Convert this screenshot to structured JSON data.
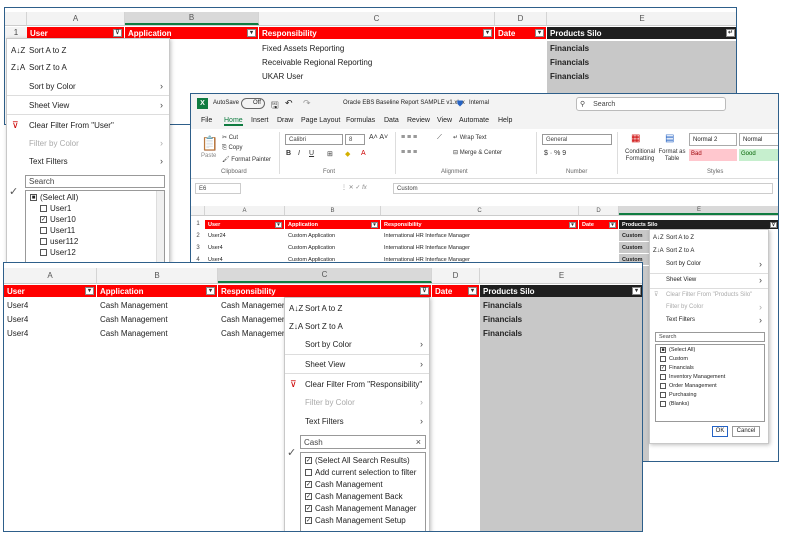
{
  "w1": {
    "cols": [
      "A",
      "B",
      "C",
      "D",
      "E"
    ],
    "row_num": "1",
    "headers": [
      "User",
      "Application",
      "Responsibility",
      "Date",
      "Products Silo"
    ],
    "rows": [
      [
        "Fixed Assets Reporting",
        "Financials"
      ],
      [
        "Receivable Regional Reporting",
        "Financials"
      ],
      [
        "UKAR User",
        "Financials"
      ]
    ],
    "menu": {
      "sort_az": "Sort A to Z",
      "sort_za": "Sort Z to A",
      "sort_color": "Sort by Color",
      "sheet_view": "Sheet View",
      "clear_filter": "Clear Filter From \"User\"",
      "filter_color": "Filter by Color",
      "text_filters": "Text Filters",
      "search_placeholder": "Search",
      "items": [
        {
          "label": "(Select All)",
          "state": "partial"
        },
        {
          "label": "User1",
          "state": "off"
        },
        {
          "label": "User10",
          "state": "on"
        },
        {
          "label": "User11",
          "state": "off"
        },
        {
          "label": "user112",
          "state": "off"
        },
        {
          "label": "User12",
          "state": "off"
        }
      ]
    }
  },
  "w2": {
    "autosave": "AutoSave",
    "autosave_state": "Off",
    "file_title": "Oracle EBS Baseline Report SAMPLE v1.xlsx",
    "sensitivity": "Internal",
    "search_placeholder": "Search",
    "tabs": [
      "File",
      "Home",
      "Insert",
      "Draw",
      "Page Layout",
      "Formulas",
      "Data",
      "Review",
      "View",
      "Automate",
      "Help"
    ],
    "active_tab": "Home",
    "clipboard": {
      "paste": "Paste",
      "cut": "Cut",
      "copy": "Copy",
      "format_painter": "Format Painter",
      "group": "Clipboard"
    },
    "font": {
      "name": "Calibri",
      "size": "8",
      "group": "Font"
    },
    "alignment": {
      "wrap": "Wrap Text",
      "merge": "Merge & Center",
      "group": "Alignment"
    },
    "number": {
      "format": "General",
      "symbols": "$ · % 9",
      "group": "Number"
    },
    "styles": {
      "cond": "Conditional Formatting",
      "fmt_table": "Format as Table",
      "normal2": "Normal 2",
      "normal": "Normal",
      "bad": "Bad",
      "good": "Good",
      "group": "Styles"
    },
    "name_box": "E6",
    "formula": "Custom",
    "cols": [
      "A",
      "B",
      "C",
      "D",
      "E"
    ],
    "row_nums": [
      "1",
      "2",
      "3",
      "4"
    ],
    "headers": [
      "User",
      "Application",
      "Responsibility",
      "Date",
      "Products Silo"
    ],
    "rows": [
      [
        "User24",
        "Custom Application",
        "International HR Interface Manager",
        "Custom"
      ],
      [
        "User4",
        "Custom Application",
        "International HR Interface Manager",
        "Custom"
      ],
      [
        "User4",
        "Custom Application",
        "International HR Interface Manager",
        "Custom"
      ]
    ],
    "menu": {
      "sort_az": "Sort A to Z",
      "sort_za": "Sort Z to A",
      "sort_color": "Sort by Color",
      "sheet_view": "Sheet View",
      "clear_filter": "Clear Filter From \"Products Silo\"",
      "filter_color": "Filter by Color",
      "text_filters": "Text Filters",
      "search_placeholder": "Search",
      "items": [
        {
          "label": "(Select All)",
          "state": "partial"
        },
        {
          "label": "Custom",
          "state": "off"
        },
        {
          "label": "Financials",
          "state": "on"
        },
        {
          "label": "Inventory Management",
          "state": "off"
        },
        {
          "label": "Order Management",
          "state": "off"
        },
        {
          "label": "Purchasing",
          "state": "off"
        },
        {
          "label": "(Blanks)",
          "state": "off"
        }
      ],
      "ok": "OK",
      "cancel": "Cancel"
    }
  },
  "w3": {
    "cols": [
      "A",
      "B",
      "C",
      "D",
      "E"
    ],
    "headers": [
      "User",
      "Application",
      "Responsibility",
      "Date",
      "Products Silo"
    ],
    "rows": [
      [
        "User4",
        "Cash Management",
        "Cash Management B",
        "Financials"
      ],
      [
        "User4",
        "Cash Management",
        "Cash Management M",
        "Financials"
      ],
      [
        "User4",
        "Cash Management",
        "Cash Management S",
        "Financials"
      ]
    ],
    "menu": {
      "sort_az": "Sort A to Z",
      "sort_za": "Sort Z to A",
      "sort_color": "Sort by Color",
      "sheet_view": "Sheet View",
      "clear_filter": "Clear Filter From \"Responsibility\"",
      "filter_color": "Filter by Color",
      "text_filters": "Text Filters",
      "search_value": "Cash",
      "items": [
        {
          "label": "(Select All Search Results)",
          "state": "on"
        },
        {
          "label": "Add current selection to filter",
          "state": "off"
        },
        {
          "label": "Cash Management",
          "state": "on"
        },
        {
          "label": "Cash Management Back",
          "state": "on"
        },
        {
          "label": "Cash Management Manager",
          "state": "on"
        },
        {
          "label": "Cash Management Setup",
          "state": "on"
        }
      ]
    }
  }
}
